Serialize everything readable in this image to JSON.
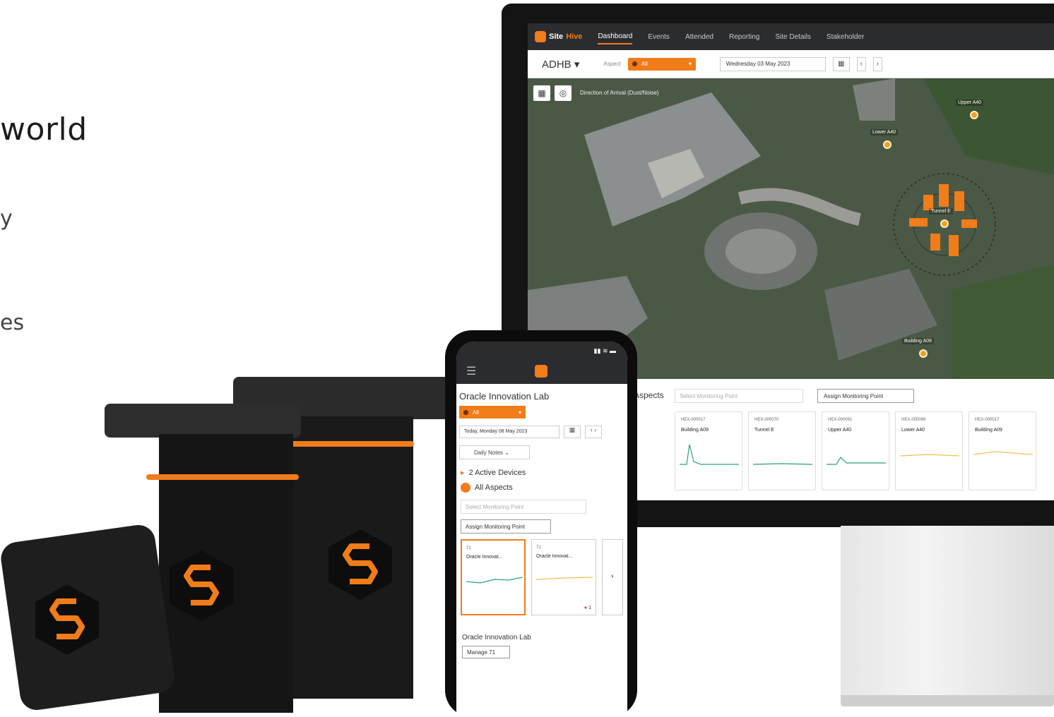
{
  "hero": {
    "word": "world",
    "frag1": "y",
    "frag2": "es"
  },
  "dashboard": {
    "brand_site": "Site",
    "brand_hive": "Hive",
    "nav": [
      "Dashboard",
      "Events",
      "Attended",
      "Reporting",
      "Site Details",
      "Stakeholder"
    ],
    "site_selector": "ADHB ▾",
    "aspect_label": "Aspect",
    "aspect_value": "All",
    "date": "Wednesday 03 May 2023",
    "map_title": "Direction of Arrival (Dust/Noise)",
    "markers": [
      "Upper A40",
      "Lower A40",
      "Tunnel E",
      "Building A09"
    ],
    "aspects_title": "Aspects",
    "select_placeholder": "Select Monitoring Point",
    "assign_button": "Assign Monitoring Point",
    "cards": [
      {
        "id": "HEX-000017",
        "name": "Building A09"
      },
      {
        "id": "HEX-000070",
        "name": "Tunnel E"
      },
      {
        "id": "HEX-000091",
        "name": "Upper A40"
      },
      {
        "id": "HEX-000068",
        "name": "Lower A40"
      },
      {
        "id": "HEX-000017",
        "name": "Building A09"
      }
    ]
  },
  "phone": {
    "title": "Oracle Innovation Lab",
    "aspect_value": "All",
    "date": "Today, Monday 08 May 2023",
    "daily_notes": "Daily Notes",
    "active_devices": "2 Active Devices",
    "all_aspects": "All Aspects",
    "select_placeholder": "Select Monitoring Point",
    "assign_button": "Assign Monitoring Point",
    "cards": [
      {
        "num": "71",
        "name": "Oracle Innovat..."
      },
      {
        "num": "71",
        "name": "Oracle Innovat..."
      }
    ],
    "alert_count": "1",
    "footer_title": "Oracle Innovation Lab",
    "manage_button": "Manage 71"
  },
  "colors": {
    "accent": "#f07c1a",
    "nav_bg": "#2b2c30",
    "hardware": "#1a1a1a"
  }
}
